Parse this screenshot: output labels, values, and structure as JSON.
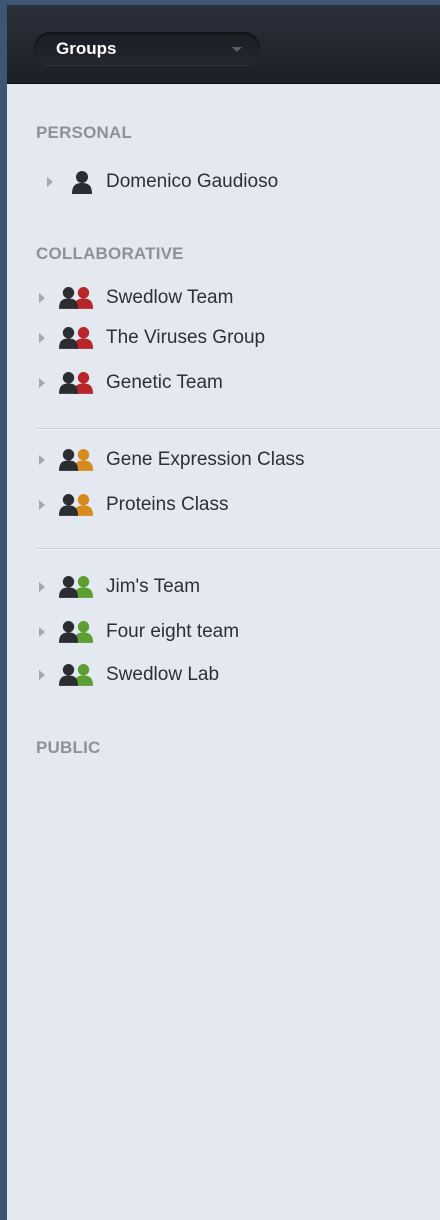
{
  "header": {
    "group_selector": {
      "label": "Groups"
    }
  },
  "sections": {
    "personal": "PERSONAL",
    "collaborative": "COLLABORATIVE",
    "public": "PUBLIC"
  },
  "colors": {
    "personal_user": "#2b2d31",
    "collaborative_group": "#b8262a",
    "class_group": "#d98a1c",
    "team_group": "#5d9e32"
  },
  "personal_items": [
    {
      "label": "Domenico Gaudioso",
      "icon": "user-icon"
    }
  ],
  "collaborative_groups": [
    {
      "label": "Swedlow Team",
      "icon": "group-icon-red"
    },
    {
      "label": "The Viruses Group",
      "icon": "group-icon-red"
    },
    {
      "label": "Genetic Team",
      "icon": "group-icon-red"
    }
  ],
  "class_groups": [
    {
      "label": "Gene Expression Class",
      "icon": "group-icon-orange"
    },
    {
      "label": "Proteins Class",
      "icon": "group-icon-orange"
    }
  ],
  "team_groups": [
    {
      "label": "Jim's Team",
      "icon": "group-icon-green"
    },
    {
      "label": "Four eight team",
      "icon": "group-icon-green"
    },
    {
      "label": "Swedlow Lab",
      "icon": "group-icon-green"
    }
  ]
}
